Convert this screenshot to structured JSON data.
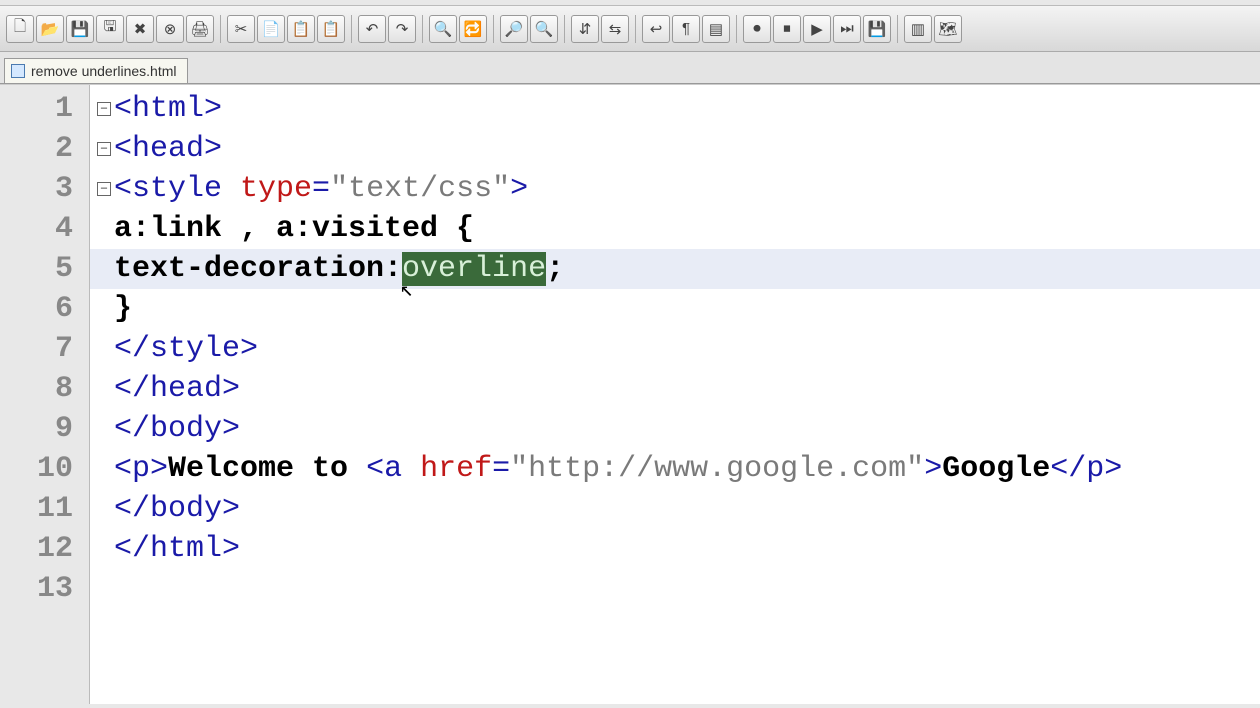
{
  "toolbar": {
    "icons": [
      "new-file",
      "open-folder",
      "save",
      "save-all",
      "close",
      "close-all",
      "print",
      "spacer",
      "cut",
      "copy",
      "paste",
      "paste-special",
      "spacer",
      "undo",
      "redo",
      "spacer",
      "find",
      "replace",
      "spacer",
      "zoom-in",
      "zoom-out",
      "spacer",
      "sync-v",
      "sync-h",
      "spacer",
      "wrap",
      "show-all",
      "indent-guide",
      "spacer",
      "record-macro",
      "stop-macro",
      "play-macro",
      "play-multi",
      "save-macro",
      "spacer",
      "toggle-panel",
      "doc-map"
    ]
  },
  "tab": {
    "filename": "remove underlines.html"
  },
  "code": {
    "lines": [
      {
        "n": 1,
        "fold": "open",
        "tokens": [
          {
            "t": "<html>",
            "c": "tag"
          }
        ]
      },
      {
        "n": 2,
        "fold": "open",
        "tokens": [
          {
            "t": "<head>",
            "c": "tag"
          }
        ]
      },
      {
        "n": 3,
        "fold": "open",
        "tokens": [
          {
            "t": "<style ",
            "c": "tag"
          },
          {
            "t": "type",
            "c": "attr"
          },
          {
            "t": "=",
            "c": "tag"
          },
          {
            "t": "\"text/css\"",
            "c": "str"
          },
          {
            "t": ">",
            "c": "tag"
          }
        ]
      },
      {
        "n": 4,
        "fold": "",
        "tokens": [
          {
            "t": "a:link , a:visited {",
            "c": "txt"
          }
        ]
      },
      {
        "n": 5,
        "fold": "",
        "hl": true,
        "tokens": [
          {
            "t": "text-decoration:",
            "c": "txt"
          },
          {
            "t": "overline",
            "c": "sel"
          },
          {
            "t": ";",
            "c": "txt"
          }
        ]
      },
      {
        "n": 6,
        "fold": "",
        "tokens": [
          {
            "t": "}",
            "c": "txt"
          }
        ]
      },
      {
        "n": 7,
        "fold": "",
        "tokens": [
          {
            "t": "</style>",
            "c": "tag"
          }
        ]
      },
      {
        "n": 8,
        "fold": "",
        "tokens": [
          {
            "t": "</head>",
            "c": "tag"
          }
        ]
      },
      {
        "n": 9,
        "fold": "",
        "tokens": [
          {
            "t": "</body>",
            "c": "tag"
          }
        ]
      },
      {
        "n": 10,
        "fold": "",
        "tokens": [
          {
            "t": "<p>",
            "c": "tag"
          },
          {
            "t": "Welcome to ",
            "c": "txt"
          },
          {
            "t": "<a ",
            "c": "tag"
          },
          {
            "t": "href",
            "c": "attr"
          },
          {
            "t": "=",
            "c": "tag"
          },
          {
            "t": "\"http://www.google.com\"",
            "c": "str"
          },
          {
            "t": ">",
            "c": "tag"
          },
          {
            "t": "Google",
            "c": "txt"
          },
          {
            "t": "</p>",
            "c": "tag"
          }
        ]
      },
      {
        "n": 11,
        "fold": "",
        "tokens": [
          {
            "t": "</body>",
            "c": "tag"
          }
        ]
      },
      {
        "n": 12,
        "fold": "",
        "tokens": [
          {
            "t": "</html>",
            "c": "tag"
          }
        ]
      },
      {
        "n": 13,
        "fold": "",
        "tokens": []
      }
    ]
  },
  "iconGlyphs": {
    "new-file": "🗋",
    "open-folder": "📂",
    "save": "💾",
    "save-all": "🖫",
    "close": "✖",
    "close-all": "⊗",
    "print": "🖨",
    "cut": "✂",
    "copy": "📄",
    "paste": "📋",
    "paste-special": "📋",
    "undo": "↶",
    "redo": "↷",
    "find": "🔍",
    "replace": "🔁",
    "zoom-in": "🔎",
    "zoom-out": "🔍",
    "sync-v": "⇵",
    "sync-h": "⇆",
    "wrap": "↩",
    "show-all": "¶",
    "indent-guide": "▤",
    "record-macro": "⏺",
    "stop-macro": "⏹",
    "play-macro": "▶",
    "play-multi": "⏭",
    "save-macro": "💾",
    "toggle-panel": "▥",
    "doc-map": "🗺"
  }
}
